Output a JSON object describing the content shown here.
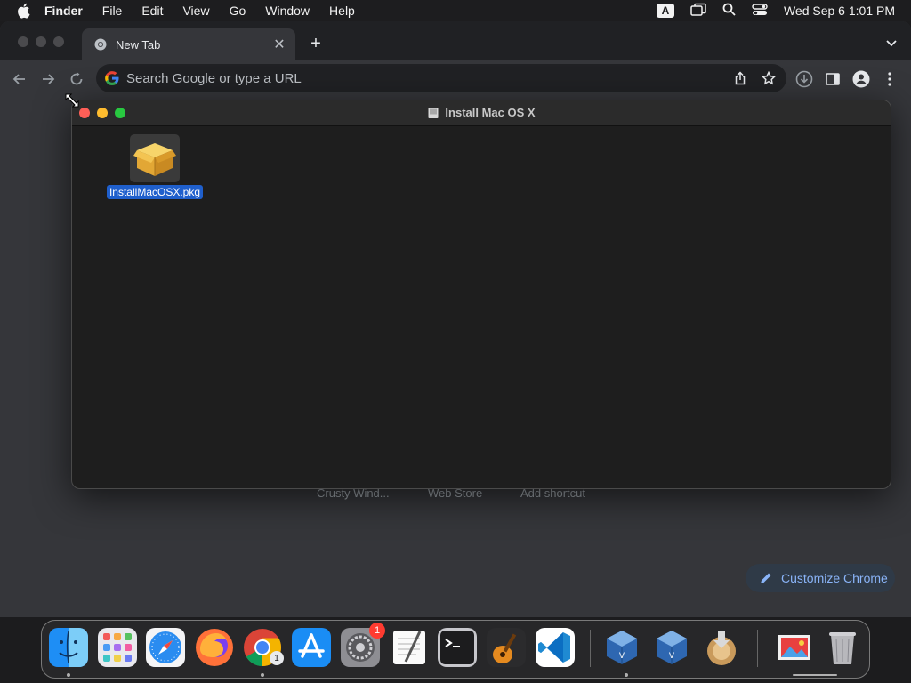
{
  "menubar": {
    "app_name": "Finder",
    "items": [
      "File",
      "Edit",
      "View",
      "Go",
      "Window",
      "Help"
    ],
    "input_source": "A",
    "clock": "Wed Sep 6  1:01 PM"
  },
  "chrome": {
    "tab": {
      "title": "New Tab"
    },
    "omnibox": {
      "placeholder": "Search Google or type a URL",
      "value": ""
    },
    "shortcuts": [
      "Crusty Wind...",
      "Web Store",
      "Add shortcut"
    ],
    "customize_label": "Customize Chrome"
  },
  "finder": {
    "title": "Install Mac OS X",
    "files": [
      {
        "name": "InstallMacOSX.pkg"
      }
    ]
  },
  "dock": {
    "apps": [
      "finder",
      "launchpad",
      "safari",
      "firefox",
      "chrome",
      "app-store",
      "system-settings",
      "textedit",
      "terminal",
      "garageband",
      "vscode",
      "virtualbox",
      "virtualbox",
      "install-os-x-lion",
      "photo-viewer",
      "trash"
    ],
    "settings_badge": "1",
    "chrome_count": "1"
  },
  "colors": {
    "accent_blue": "#8ab4f8",
    "selection": "#1f5fcc",
    "close": "#ff5f57",
    "minimize": "#febc2e",
    "maximize": "#28c840",
    "badge": "#ff3b30"
  }
}
